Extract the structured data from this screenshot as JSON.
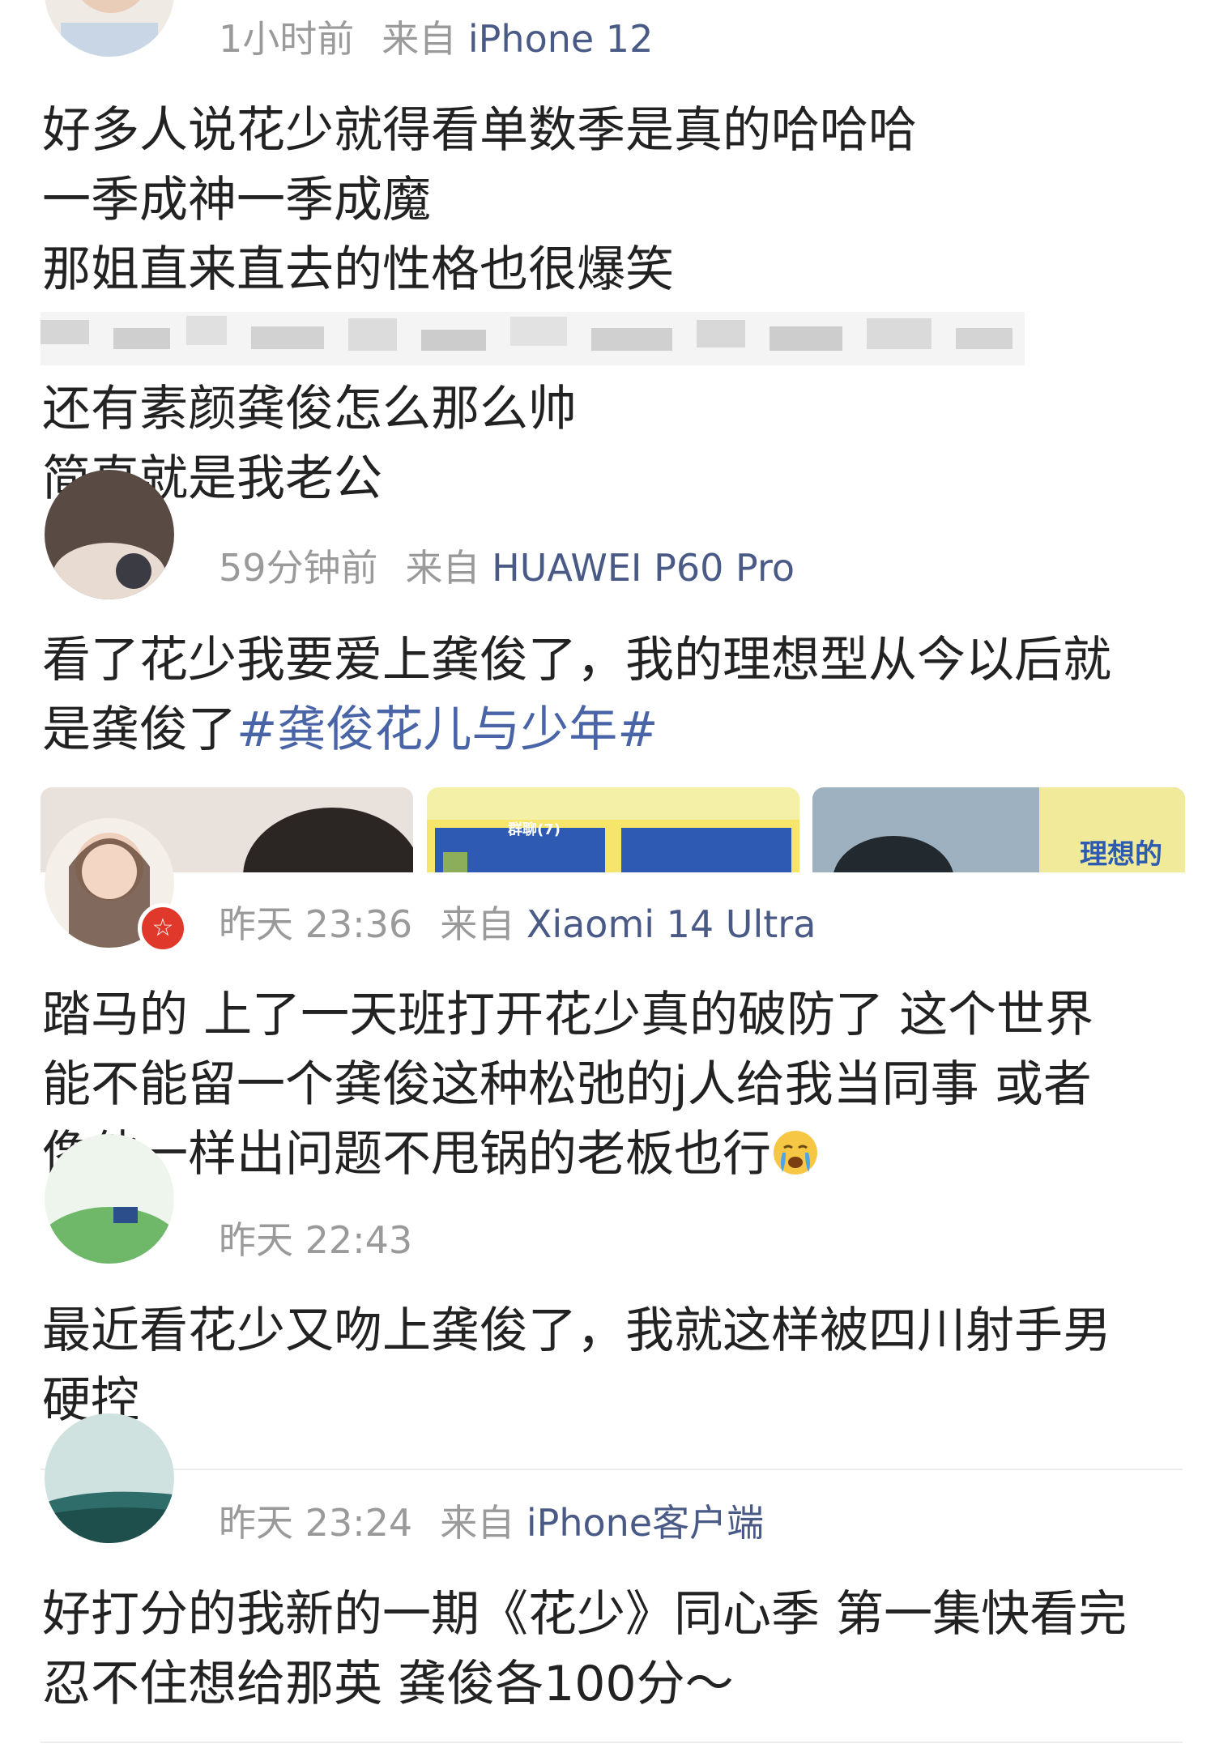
{
  "posts": [
    {
      "time": "1小时前",
      "source_prefix": "来自",
      "device": "iPhone 12",
      "lines": [
        "好多人说花少就得看单数季是真的哈哈哈",
        "一季成神一季成魔",
        "那姐直来直去的性格也很爆笑",
        "还有素颜龚俊怎么那么帅",
        "简直就是我老公"
      ]
    },
    {
      "time": "59分钟前",
      "source_prefix": "来自",
      "device": "HUAWEI P60 Pro",
      "lines": [
        "看了花少我要爱上龚俊了，我的理想型从今以后就",
        "是龚俊了"
      ],
      "hashtag": "#龚俊花儿与少年#",
      "thumbnails": [
        {
          "label": ""
        },
        {
          "label": "群聊(7)"
        },
        {
          "label": "理想的"
        }
      ]
    },
    {
      "time": "昨天 23:36",
      "source_prefix": "来自",
      "device": "Xiaomi 14 Ultra",
      "badge": "☆",
      "lines": [
        "踏马的 上了一天班打开花少真的破防了 这个世界",
        "能不能留一个龚俊这种松弛的j人给我当同事 或者",
        "像他一样出问题不甩锅的老板也行"
      ],
      "emoji_icon": "crying-face-emoji"
    },
    {
      "time": "昨天 22:43",
      "lines": [
        "最近看花少又吻上龚俊了，我就这样被四川射手男",
        "硬控"
      ]
    },
    {
      "time": "昨天 23:24",
      "source_prefix": "来自",
      "device": "iPhone客户端",
      "lines": [
        "好打分的我新的一期《花少》同心季 第一集快看完",
        "忍不住想给那英 龚俊各100分～"
      ]
    }
  ],
  "colors": {
    "meta_gray": "#9a9a9a",
    "device_blue": "#4a5a86",
    "hashtag_blue": "#4a64a8",
    "badge_red": "#e0392b",
    "divider": "#ececec"
  }
}
